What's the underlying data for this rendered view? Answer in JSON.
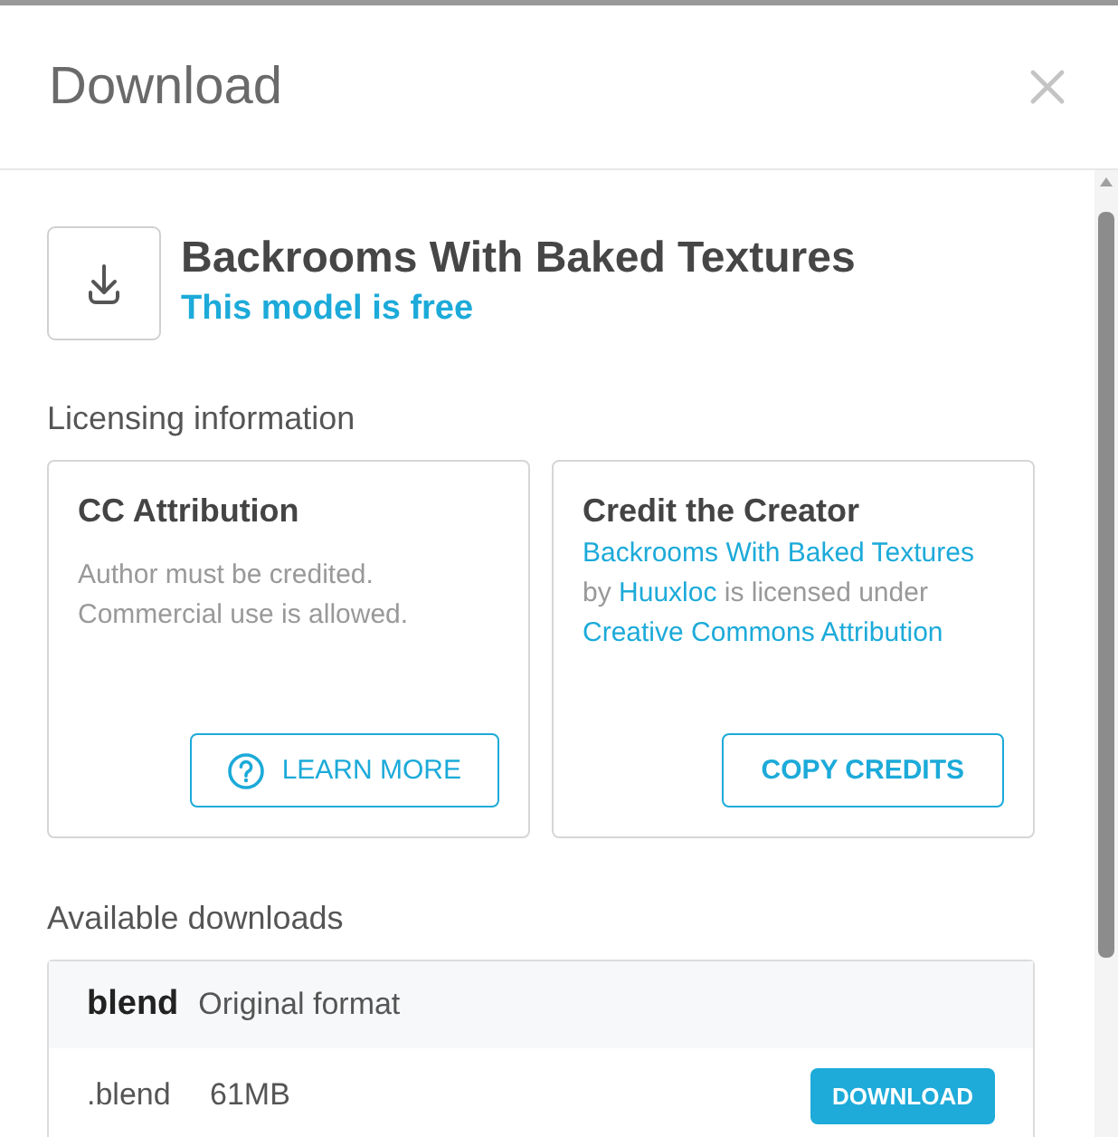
{
  "dialog": {
    "title": "Download"
  },
  "model": {
    "name": "Backrooms With Baked Textures",
    "price_note": "This model is free"
  },
  "licensing": {
    "heading": "Licensing information",
    "cards": [
      {
        "kind": "license",
        "title": "CC Attribution",
        "description": "Author must be credited. Commercial use is allowed.",
        "button": {
          "label": "LEARN MORE"
        }
      },
      {
        "kind": "credit",
        "title": "Credit the Creator",
        "credit": [
          {
            "kind": "link",
            "text": "Backrooms With Baked Textures"
          },
          {
            "kind": "text",
            "text": "by"
          },
          {
            "kind": "link",
            "text": "Huuxloc"
          },
          {
            "kind": "text",
            "text": "is licensed under"
          },
          {
            "kind": "link",
            "text": "Creative Commons Attribution"
          }
        ],
        "button": {
          "label": "COPY CREDITS"
        }
      }
    ]
  },
  "downloads": {
    "heading": "Available downloads",
    "formats": [
      {
        "name": "blend",
        "description": "Original format",
        "files": [
          {
            "extension": ".blend",
            "size": "61MB",
            "button": "DOWNLOAD"
          }
        ]
      }
    ]
  }
}
